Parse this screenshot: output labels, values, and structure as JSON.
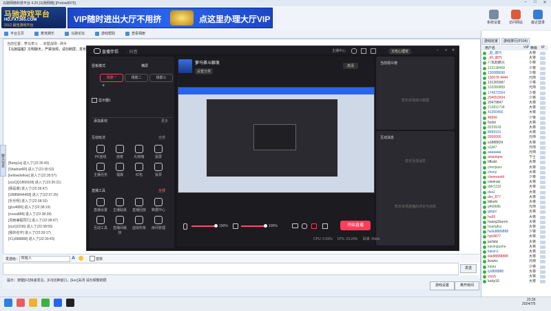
{
  "window": {
    "title": "马驰网络科技平台 4.20 [马驰网络] [Prelow8975]"
  },
  "banner": {
    "logo_line1": "马驰游戏平台",
    "logo_line2": "HD.FXT365.COM",
    "logo_line3": "2012 最佳游戏平台",
    "ad_left": "VIP随时进出大厅不用挤",
    "ad_right": "点这里办理大厅VIP",
    "buttons": [
      {
        "label": "系统设置"
      },
      {
        "label": "访问网站"
      },
      {
        "label": "最近登录"
      },
      {
        "label": "退出平台"
      }
    ]
  },
  "toolbar": {
    "items": [
      {
        "label": "平台主页"
      },
      {
        "label": "麦克娱乐"
      },
      {
        "label": "马驰论坛"
      },
      {
        "label": "游戏帮助"
      },
      {
        "label": "查看相册"
      }
    ]
  },
  "chat": {
    "location": "当前位置：萝马茶斗 → 赤壁战场 - 碎片",
    "notice": "【马驰提醒】文明聊天，严禁违规，请勿刷屏，发布广告，违者处理。",
    "side_tab": "聊天信息",
    "logs": [
      "[Bang1a] 进入了(22:35:43)",
      "[Shadow6R] 进入了(22:35:52)",
      "[kellowdellow] 进入了(22:35:57)",
      "[zzzQQ1866928] 进入了(22:36:21)",
      "[我是谁] 进入了(22:36:47)",
      "[18889844468] 进入了(22:37:25)",
      "[乐乐呀] 进入了(22:38:10)",
      "[ghs4880] 进入了(22:38:19)",
      "[rouva888] 进入了(22:38:28)",
      "[风雨兼程同行] 进入了(22:38:47)",
      "[zzzQ2236] 进入了(22:38:55)",
      "[我的名字] 进入了(22:39:17)",
      "[X1y888888] 进入了(22:39:43)"
    ],
    "send_target_label": "发送给：",
    "send_target_value": "所有人",
    "shortcut_label": "音效",
    "send_button": "发送",
    "status_hint": "提示：按键[F2]快速发言，[F3]切换窗口，[Esc]关闭 请勿频繁刷屏",
    "btn_settings": "游戏设置",
    "btn_leave": "离开房间"
  },
  "users": {
    "tabs": [
      {
        "label": "游戏玩家"
      },
      {
        "label": "游戏排行(P104)"
      }
    ],
    "columns": [
      "用户名",
      "VIP",
      "等级",
      "IP"
    ],
    "rows": [
      {
        "name": "_赵_鼎代",
        "rank": "大将"
      },
      {
        "name": "_k0_鼎代",
        "rank": "大将"
      },
      {
        "name": "八瓦赵鹏贝",
        "rank": "小将"
      },
      {
        "name": "123138468",
        "rank": "少将"
      },
      {
        "name": "130088698",
        "rank": "少将"
      },
      {
        "name": "130578 4444",
        "rank": "元帅"
      },
      {
        "name": "131265987",
        "rank": "少将"
      },
      {
        "name": "132080889",
        "rank": "元帅"
      },
      {
        "name": "174572254",
        "rank": "少将"
      },
      {
        "name": "204052604",
        "rank": "少将"
      },
      {
        "name": "20479847",
        "rank": "大将"
      },
      {
        "name": "213811734",
        "rank": "大将"
      },
      {
        "name": "41350466",
        "rank": "大将"
      },
      {
        "name": "46966",
        "rank": "少将"
      },
      {
        "name": "6xdst",
        "rank": "大将"
      },
      {
        "name": "8229918",
        "rank": "大将"
      },
      {
        "name": "8999191",
        "rank": "大将"
      },
      {
        "name": "9300000",
        "rank": "元帅"
      },
      {
        "name": "a1888829",
        "rank": "大将"
      },
      {
        "name": "a1jl47",
        "rank": "元帅"
      },
      {
        "name": "aaaaaaa",
        "rank": "元帅"
      },
      {
        "name": "anlanlqne",
        "rank": "下士"
      },
      {
        "name": "bfbdzt",
        "rank": "大将"
      },
      {
        "name": "chenjiaxx",
        "rank": "大将"
      },
      {
        "name": "chuny",
        "rank": "大将"
      },
      {
        "name": "cleeeeenld",
        "rank": "少将"
      },
      {
        "name": "cleeiraiz",
        "rank": "大将"
      },
      {
        "name": "dj4c1115",
        "rank": "大将"
      },
      {
        "name": "dsa1",
        "rank": "大将"
      },
      {
        "name": "dsv_877",
        "rank": "大将"
      },
      {
        "name": "falkehi",
        "rank": "大将"
      },
      {
        "name": "g4k8k8b",
        "rank": "元帅"
      },
      {
        "name": "gjxgsi",
        "rank": "大将"
      },
      {
        "name": "hu99",
        "rank": "大将"
      },
      {
        "name": "huang1buren",
        "rank": "大将"
      },
      {
        "name": "huangfuy",
        "rank": "大将"
      },
      {
        "name": "huilu8889888",
        "rank": "少将"
      },
      {
        "name": "hyb9877",
        "rank": "大将"
      },
      {
        "name": "jacfaliz",
        "rank": "大将"
      },
      {
        "name": "kaixinguohe",
        "rank": "大将"
      },
      {
        "name": "kaixin1",
        "rank": "大将"
      },
      {
        "name": "kkk88888888",
        "rank": "大将"
      },
      {
        "name": "llwwhx",
        "rank": "元帅"
      },
      {
        "name": "lopau",
        "rank": "少将"
      },
      {
        "name": "ly0888888",
        "rank": "大将"
      },
      {
        "name": "yyyyy",
        "rank": "大将"
      },
      {
        "name": "lucky16",
        "rank": "大将"
      }
    ]
  },
  "stream_app": {
    "title": "直播伴侣",
    "title_suffix": "· 抖音",
    "header_buttons": [
      "主播中心",
      "设置",
      "反馈",
      "主页",
      "退出"
    ],
    "user_badge": "又吃心理安",
    "scene_mode": "竖板模式",
    "scene_mode2": "横屏",
    "scenes": [
      {
        "label": "场景一"
      },
      {
        "label": "场景二"
      },
      {
        "label": "场景三"
      }
    ],
    "source_item": "显示器1",
    "add_source": "添加素材",
    "add_source_more": "更多",
    "interaction_title": "互动玩法",
    "interaction_more": "全部",
    "interaction_tools": [
      "PK连线",
      "连麦",
      "礼物墙",
      "投屏",
      "主播任务",
      "福袋",
      "红包",
      "投票"
    ],
    "live_tools_title": "直播工具",
    "live_tools_more": "全部",
    "live_tools": [
      "直播设置",
      "主播贴纸",
      "直播回放",
      "数据中心",
      "互动工具",
      "直播间装扮",
      "虚拟形象",
      "房间管理"
    ],
    "streamer_name": "萝马茶斗聊发",
    "streamer_tag": "设置分类",
    "quality": "高清",
    "right_panel1_title": "当前观众榜",
    "right_panel1_hint": "暂无本场观众数据",
    "right_panel2_title": "互动消息",
    "right_panel2_hint": "暂无互动消息",
    "right_panel2_hint2": "暂无本场直播的评论与动态",
    "mic_volume": "100%",
    "speaker_volume": "100%",
    "start_button": "开始直播",
    "perf_cpu": "CPU: 0.59%",
    "perf_fps": "FPS: 23.24%",
    "perf_bitrate": "码率: 0kb/s"
  },
  "taskbar": {
    "time": "22:39",
    "date": "2024/7/5"
  },
  "colors": {
    "accent": "#ff3d5a",
    "brand": "#1c46c8",
    "online": "#3cb043"
  }
}
